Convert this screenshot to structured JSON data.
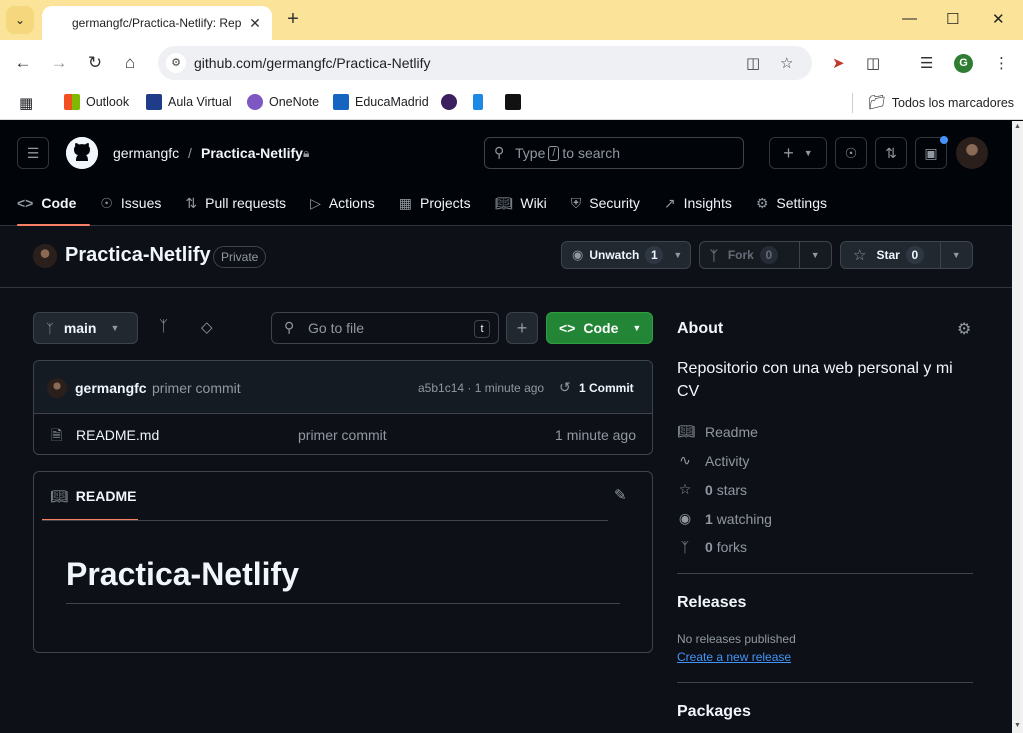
{
  "browser": {
    "tab_title": "germangfc/Practica-Netlify: Rep",
    "url": "github.com/germangfc/Practica-Netlify",
    "bookmarks": [
      "Outlook",
      "Aula Virtual",
      "OneNote",
      "EducaMadrid"
    ],
    "all_bookmarks": "Todos los marcadores",
    "profile_initial": "G"
  },
  "header": {
    "owner": "germangfc",
    "separator": "/",
    "repo": "Practica-Netlify",
    "search_placeholder_pre": "Type",
    "search_key": "/",
    "search_placeholder_post": "to search"
  },
  "repo_nav": [
    {
      "label": "Code",
      "icon": "code-icon"
    },
    {
      "label": "Issues",
      "icon": "issue-icon"
    },
    {
      "label": "Pull requests",
      "icon": "pull-request-icon"
    },
    {
      "label": "Actions",
      "icon": "play-icon"
    },
    {
      "label": "Projects",
      "icon": "table-icon"
    },
    {
      "label": "Wiki",
      "icon": "book-icon"
    },
    {
      "label": "Security",
      "icon": "shield-icon"
    },
    {
      "label": "Insights",
      "icon": "graph-icon"
    },
    {
      "label": "Settings",
      "icon": "gear-icon"
    }
  ],
  "repo_title": {
    "name": "Practica-Netlify",
    "visibility": "Private",
    "unwatch_label": "Unwatch",
    "watch_count": "1",
    "fork_label": "Fork",
    "fork_count": "0",
    "star_label": "Star",
    "star_count": "0"
  },
  "file_nav": {
    "branch": "main",
    "goto_placeholder": "Go to file",
    "goto_key": "t",
    "code_label": "Code"
  },
  "latest_commit": {
    "author": "germangfc",
    "message": "primer commit",
    "hash_time": "a5b1c14 · 1 minute ago",
    "commits_label": "1 Commit"
  },
  "files": [
    {
      "name": "README.md",
      "message": "primer commit",
      "time": "1 minute ago"
    }
  ],
  "readme": {
    "tab_label": "README",
    "heading": "Practica-Netlify"
  },
  "about": {
    "title": "About",
    "description": "Repositorio con una web personal y mi CV",
    "readme": "Readme",
    "activity": "Activity",
    "stars_count": "0",
    "stars_label": "stars",
    "watching_count": "1",
    "watching_label": "watching",
    "forks_count": "0",
    "forks_label": "forks"
  },
  "releases": {
    "title": "Releases",
    "empty": "No releases published",
    "create_link": "Create a new release"
  },
  "packages": {
    "title": "Packages"
  },
  "colors": {
    "accent_green": "#238636",
    "underline": "#f78166",
    "link": "#4493f8",
    "bg": "#0d1117"
  }
}
